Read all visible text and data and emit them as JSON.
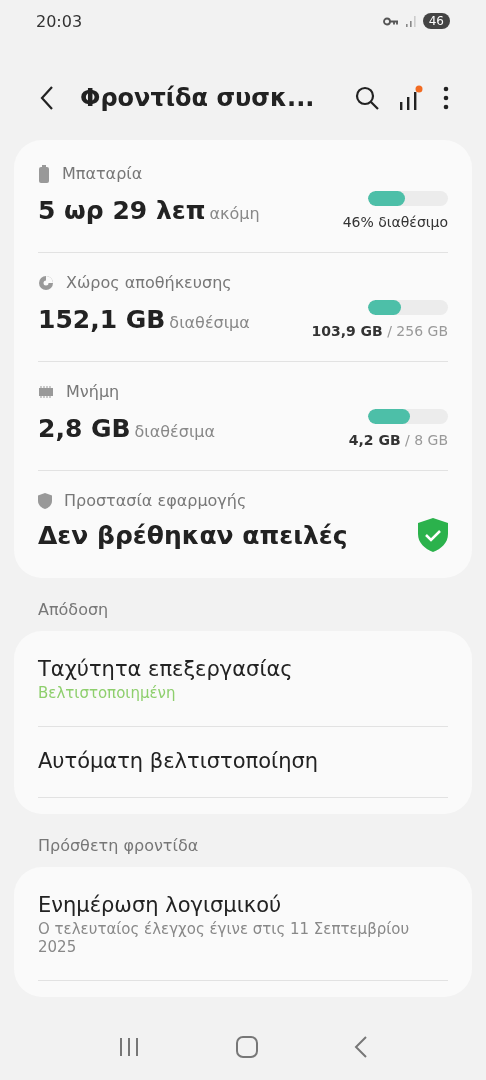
{
  "status_bar": {
    "time": "20:03",
    "battery": "46"
  },
  "header": {
    "title": "Φροντίδα συσκ...",
    "notification_dot": true
  },
  "stats": [
    {
      "kind": "battery",
      "label": "Μπαταρία",
      "value": "5 ωρ 29 λεπ",
      "suffix": "ακόμη",
      "level": 0.46,
      "reading": "46% διαθέσιμο"
    },
    {
      "kind": "storage",
      "label": "Χώρος αποθήκευσης",
      "value": "152,1 GB",
      "suffix": "διαθέσιμα",
      "level": 0.41,
      "reading": "**103,9 GB** / 256 GB"
    },
    {
      "kind": "memory",
      "label": "Μνήμη",
      "value": "2,8 GB",
      "suffix": "διαθέσιμα",
      "level": 0.53,
      "reading": "**4,2 GB** / 8 GB"
    },
    {
      "kind": "protection",
      "label": "Προστασία εφαρμογής",
      "value": "Δεν βρέθηκαν απειλές"
    }
  ],
  "sections": [
    {
      "title": "Απόδοση",
      "items": [
        {
          "title": "Ταχύτητα επεξεργασίας",
          "subtitle": "Βελτιστοποιημένη",
          "kind": "good"
        },
        {
          "title": "Αυτόματη βελτιστοποίηση"
        }
      ]
    },
    {
      "title": "Πρόσθετη φροντίδα",
      "items": [
        {
          "title": "Ενημέρωση λογισμικού",
          "subtitle": "Ο τελευταίος έλεγχος έγινε στις 11 Σεπτεμβρίου 2025",
          "kind": "plain"
        }
      ]
    }
  ]
}
